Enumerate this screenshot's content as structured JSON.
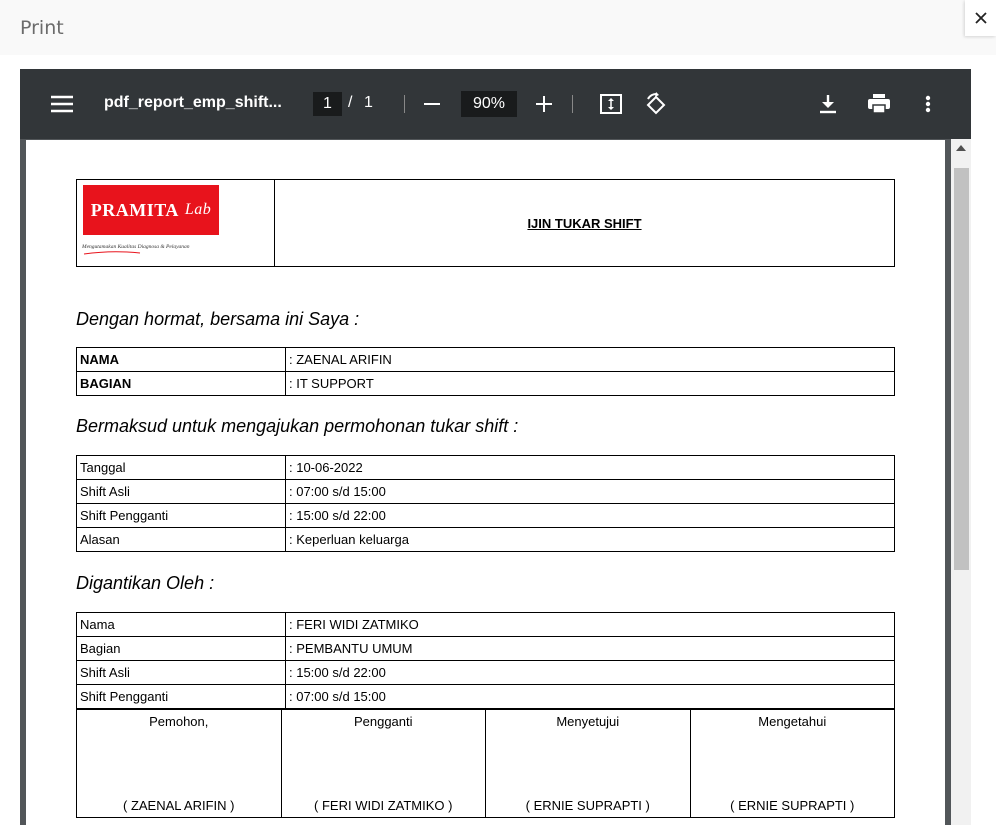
{
  "modal": {
    "title": "Print",
    "close_icon": "close-icon"
  },
  "viewer": {
    "toolbar": {
      "menu_icon": "menu-icon",
      "document_title": "pdf_report_emp_shift...",
      "current_page": "1",
      "page_separator": "/",
      "total_pages": "1",
      "zoom_out_icon": "minus-icon",
      "zoom_level": "90%",
      "zoom_in_icon": "plus-icon",
      "fit_icon": "fit-page-icon",
      "rotate_icon": "rotate-icon",
      "download_icon": "download-icon",
      "print_icon": "print-icon",
      "more_icon": "more-vert-icon"
    },
    "colors": {
      "toolbar_bg": "#323639",
      "viewer_bg": "#525659",
      "logo_red": "#e8131c"
    }
  },
  "document": {
    "logo": {
      "brand": "PRAMITA",
      "brand_script": "Lab",
      "tagline": "Mengutamakan Kualitas Diagnosa & Pelayanan"
    },
    "title": "IJIN TUKAR SHIFT",
    "intro": "Dengan hormat, bersama ini Saya :",
    "applicant": [
      {
        "label": "NAMA",
        "value": ":  ZAENAL ARIFIN"
      },
      {
        "label": "BAGIAN",
        "value": ":  IT SUPPORT"
      }
    ],
    "request_heading": "Bermaksud untuk mengajukan permohonan tukar shift :",
    "request": [
      {
        "label": "Tanggal",
        "value": ":  10-06-2022"
      },
      {
        "label": "Shift Asli",
        "value": ":  07:00 s/d 15:00"
      },
      {
        "label": "Shift Pengganti",
        "value": ":  15:00 s/d 22:00"
      },
      {
        "label": "Alasan",
        "value": ":  Keperluan keluarga"
      }
    ],
    "replacement_heading": "Digantikan Oleh :",
    "replacement": [
      {
        "label": "Nama",
        "value": ":  FERI WIDI ZATMIKO"
      },
      {
        "label": "Bagian",
        "value": ":  PEMBANTU UMUM"
      },
      {
        "label": "Shift Asli",
        "value": ":  15:00 s/d 22:00"
      },
      {
        "label": "Shift Pengganti",
        "value": ":  07:00 s/d 15:00"
      }
    ],
    "signatures": [
      {
        "role": "Pemohon,",
        "name": "( ZAENAL ARIFIN )"
      },
      {
        "role": "Pengganti",
        "name": "( FERI WIDI ZATMIKO )"
      },
      {
        "role": "Menyetujui",
        "name": "( ERNIE SUPRAPTI )"
      },
      {
        "role": "Mengetahui",
        "name": "( ERNIE SUPRAPTI )"
      }
    ]
  }
}
